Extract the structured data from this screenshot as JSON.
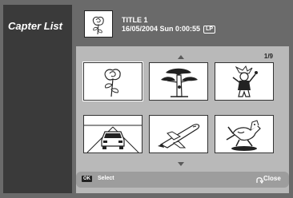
{
  "sidebar": {
    "title": "Capter List"
  },
  "header": {
    "title": "TITLE 1",
    "date_time": "16/05/2004 Sun 0:00:55",
    "mode_badge": "LP",
    "thumbnail_icon": "rose-icon"
  },
  "panel": {
    "page": "1/9",
    "thumbnails": [
      {
        "icon": "rose-icon"
      },
      {
        "icon": "tree-icon"
      },
      {
        "icon": "jester-icon"
      },
      {
        "icon": "car-icon"
      },
      {
        "icon": "space-shuttle-icon"
      },
      {
        "icon": "dog-icon"
      }
    ]
  },
  "footer": {
    "ok_badge": "OK",
    "select_label": "Select",
    "close_label": "Close"
  },
  "colors": {
    "background": "#6a6a6a",
    "sidebar": "#3a3a3a",
    "panel": "#b9b9b9",
    "footer": "#9d9d9d"
  }
}
